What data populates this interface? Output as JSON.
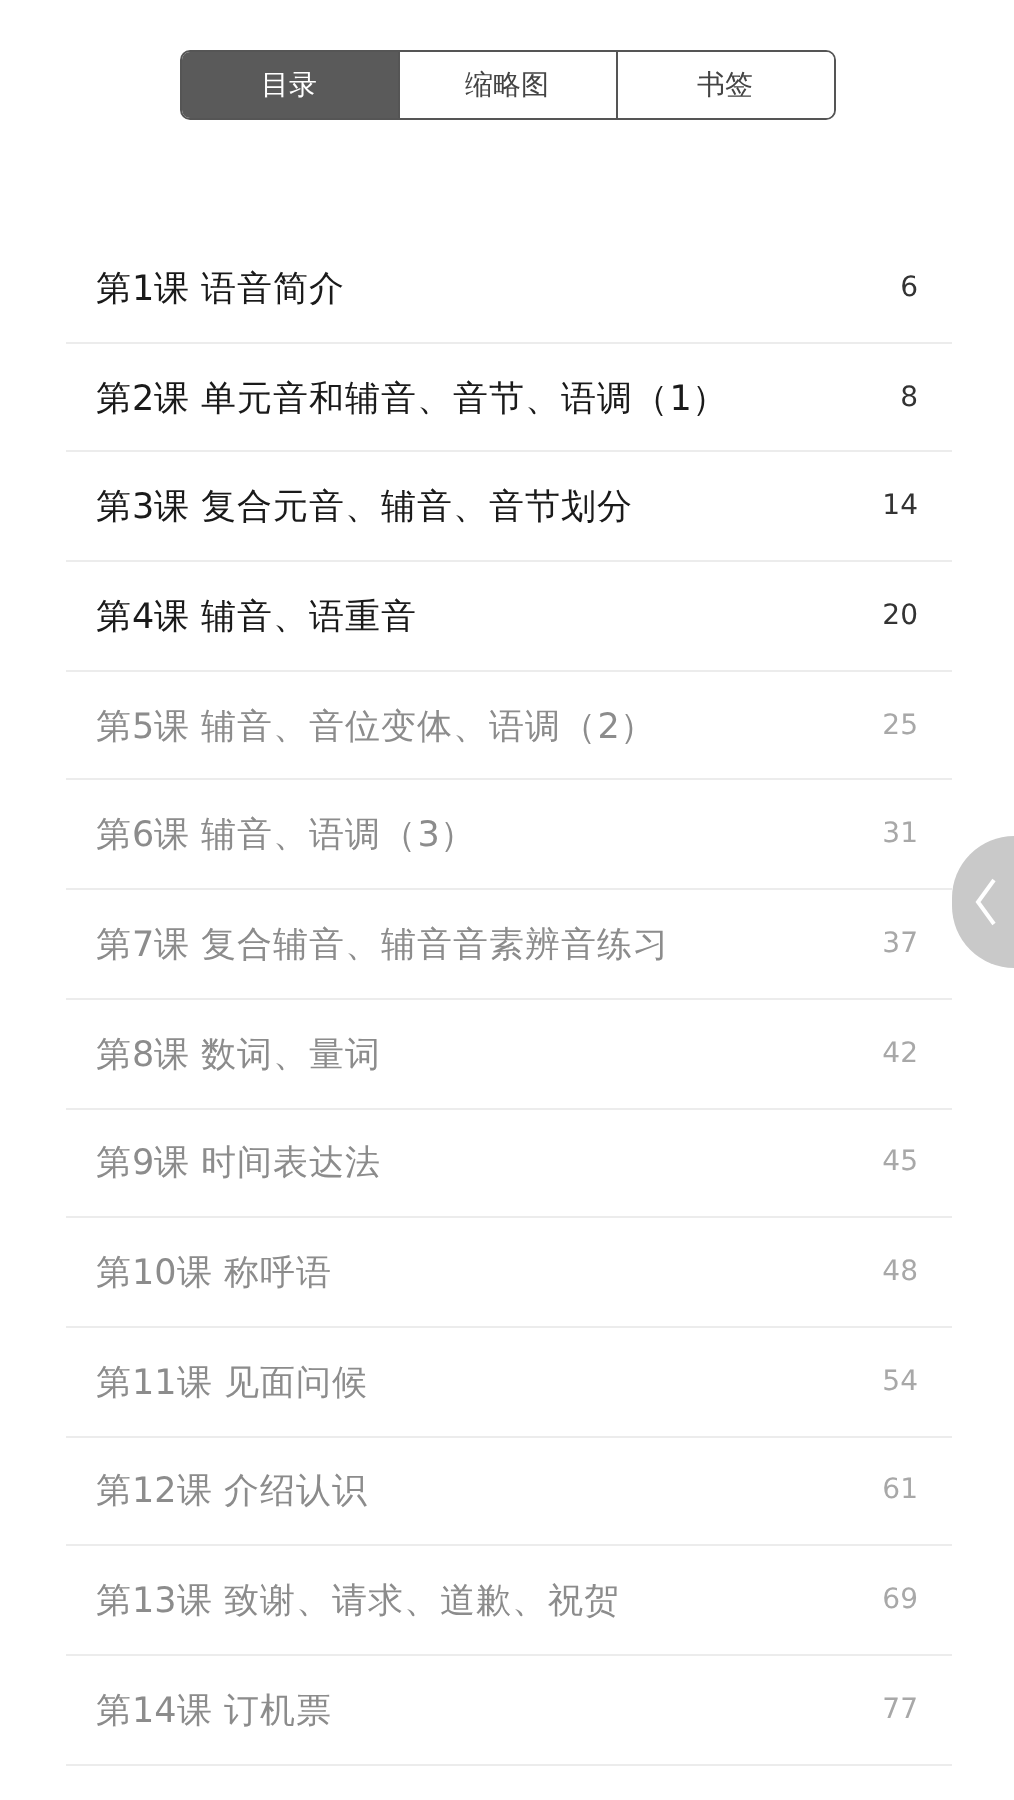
{
  "tabs": [
    {
      "label": "目录",
      "selected": true
    },
    {
      "label": "缩略图",
      "selected": false
    },
    {
      "label": "书签",
      "selected": false
    }
  ],
  "chapters": [
    {
      "title": "第1课 语音简介",
      "page": "6",
      "dimmed": false
    },
    {
      "title": "第2课 单元音和辅音、音节、语调（1）",
      "page": "8",
      "dimmed": false
    },
    {
      "title": "第3课 复合元音、辅音、音节划分",
      "page": "14",
      "dimmed": false
    },
    {
      "title": "第4课 辅音、语重音",
      "page": "20",
      "dimmed": false
    },
    {
      "title": "第5课 辅音、音位变体、语调（2）",
      "page": "25",
      "dimmed": true
    },
    {
      "title": "第6课 辅音、语调（3）",
      "page": "31",
      "dimmed": true
    },
    {
      "title": "第7课 复合辅音、辅音音素辨音练习",
      "page": "37",
      "dimmed": true
    },
    {
      "title": "第8课 数词、量词",
      "page": "42",
      "dimmed": true
    },
    {
      "title": "第9课 时间表达法",
      "page": "45",
      "dimmed": true
    },
    {
      "title": "第10课 称呼语",
      "page": "48",
      "dimmed": true
    },
    {
      "title": "第11课 见面问候",
      "page": "54",
      "dimmed": true
    },
    {
      "title": "第12课 介绍认识",
      "page": "61",
      "dimmed": true
    },
    {
      "title": "第13课 致谢、请求、道歉、祝贺",
      "page": "69",
      "dimmed": true
    },
    {
      "title": "第14课 订机票",
      "page": "77",
      "dimmed": true
    }
  ]
}
